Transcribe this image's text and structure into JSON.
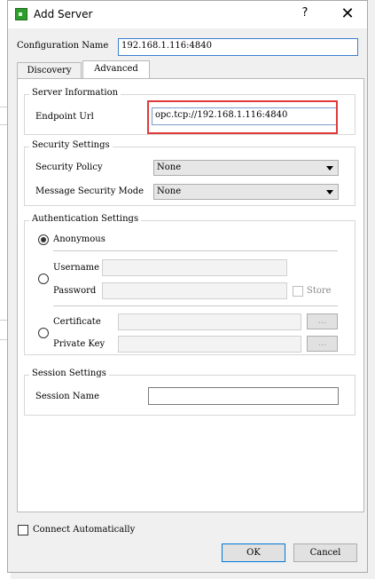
{
  "window": {
    "title": "Add Server",
    "help_label": "?",
    "close_label": "✕"
  },
  "config": {
    "label": "Configuration Name",
    "value": "192.168.1.116:4840"
  },
  "tabs": [
    {
      "label": "Discovery"
    },
    {
      "label": "Advanced"
    }
  ],
  "server_info": {
    "title": "Server Information",
    "endpoint_label": "Endpoint Url",
    "endpoint_value": "opc.tcp://192.168.1.116:4840"
  },
  "security": {
    "title": "Security Settings",
    "policy_label": "Security Policy",
    "policy_value": "None",
    "mode_label": "Message Security Mode",
    "mode_value": "None"
  },
  "auth": {
    "title": "Authentication Settings",
    "anonymous_label": "Anonymous",
    "username_label": "Username",
    "password_label": "Password",
    "store_label": "Store",
    "certificate_label": "Certificate",
    "private_key_label": "Private Key",
    "browse_label": "..."
  },
  "session": {
    "title": "Session Settings",
    "name_label": "Session Name",
    "name_value": ""
  },
  "footer": {
    "connect_auto_label": "Connect Automatically",
    "ok_label": "OK",
    "cancel_label": "Cancel"
  },
  "colors": {
    "highlight": "#e03a3a",
    "accent": "#0078d7"
  }
}
